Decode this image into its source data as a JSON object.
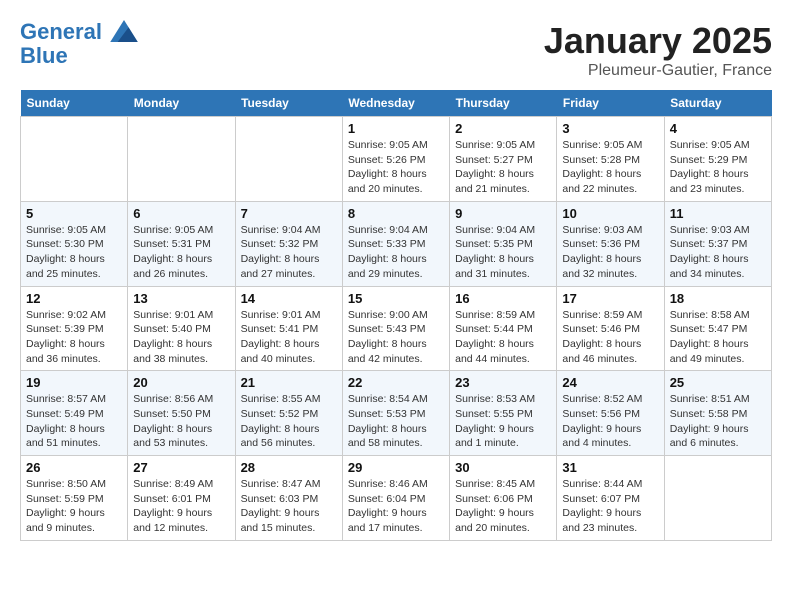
{
  "header": {
    "logo_line1": "General",
    "logo_line2": "Blue",
    "month": "January 2025",
    "location": "Pleumeur-Gautier, France"
  },
  "weekdays": [
    "Sunday",
    "Monday",
    "Tuesday",
    "Wednesday",
    "Thursday",
    "Friday",
    "Saturday"
  ],
  "weeks": [
    [
      {
        "day": "",
        "info": ""
      },
      {
        "day": "",
        "info": ""
      },
      {
        "day": "",
        "info": ""
      },
      {
        "day": "1",
        "info": "Sunrise: 9:05 AM\nSunset: 5:26 PM\nDaylight: 8 hours\nand 20 minutes."
      },
      {
        "day": "2",
        "info": "Sunrise: 9:05 AM\nSunset: 5:27 PM\nDaylight: 8 hours\nand 21 minutes."
      },
      {
        "day": "3",
        "info": "Sunrise: 9:05 AM\nSunset: 5:28 PM\nDaylight: 8 hours\nand 22 minutes."
      },
      {
        "day": "4",
        "info": "Sunrise: 9:05 AM\nSunset: 5:29 PM\nDaylight: 8 hours\nand 23 minutes."
      }
    ],
    [
      {
        "day": "5",
        "info": "Sunrise: 9:05 AM\nSunset: 5:30 PM\nDaylight: 8 hours\nand 25 minutes."
      },
      {
        "day": "6",
        "info": "Sunrise: 9:05 AM\nSunset: 5:31 PM\nDaylight: 8 hours\nand 26 minutes."
      },
      {
        "day": "7",
        "info": "Sunrise: 9:04 AM\nSunset: 5:32 PM\nDaylight: 8 hours\nand 27 minutes."
      },
      {
        "day": "8",
        "info": "Sunrise: 9:04 AM\nSunset: 5:33 PM\nDaylight: 8 hours\nand 29 minutes."
      },
      {
        "day": "9",
        "info": "Sunrise: 9:04 AM\nSunset: 5:35 PM\nDaylight: 8 hours\nand 31 minutes."
      },
      {
        "day": "10",
        "info": "Sunrise: 9:03 AM\nSunset: 5:36 PM\nDaylight: 8 hours\nand 32 minutes."
      },
      {
        "day": "11",
        "info": "Sunrise: 9:03 AM\nSunset: 5:37 PM\nDaylight: 8 hours\nand 34 minutes."
      }
    ],
    [
      {
        "day": "12",
        "info": "Sunrise: 9:02 AM\nSunset: 5:39 PM\nDaylight: 8 hours\nand 36 minutes."
      },
      {
        "day": "13",
        "info": "Sunrise: 9:01 AM\nSunset: 5:40 PM\nDaylight: 8 hours\nand 38 minutes."
      },
      {
        "day": "14",
        "info": "Sunrise: 9:01 AM\nSunset: 5:41 PM\nDaylight: 8 hours\nand 40 minutes."
      },
      {
        "day": "15",
        "info": "Sunrise: 9:00 AM\nSunset: 5:43 PM\nDaylight: 8 hours\nand 42 minutes."
      },
      {
        "day": "16",
        "info": "Sunrise: 8:59 AM\nSunset: 5:44 PM\nDaylight: 8 hours\nand 44 minutes."
      },
      {
        "day": "17",
        "info": "Sunrise: 8:59 AM\nSunset: 5:46 PM\nDaylight: 8 hours\nand 46 minutes."
      },
      {
        "day": "18",
        "info": "Sunrise: 8:58 AM\nSunset: 5:47 PM\nDaylight: 8 hours\nand 49 minutes."
      }
    ],
    [
      {
        "day": "19",
        "info": "Sunrise: 8:57 AM\nSunset: 5:49 PM\nDaylight: 8 hours\nand 51 minutes."
      },
      {
        "day": "20",
        "info": "Sunrise: 8:56 AM\nSunset: 5:50 PM\nDaylight: 8 hours\nand 53 minutes."
      },
      {
        "day": "21",
        "info": "Sunrise: 8:55 AM\nSunset: 5:52 PM\nDaylight: 8 hours\nand 56 minutes."
      },
      {
        "day": "22",
        "info": "Sunrise: 8:54 AM\nSunset: 5:53 PM\nDaylight: 8 hours\nand 58 minutes."
      },
      {
        "day": "23",
        "info": "Sunrise: 8:53 AM\nSunset: 5:55 PM\nDaylight: 9 hours\nand 1 minute."
      },
      {
        "day": "24",
        "info": "Sunrise: 8:52 AM\nSunset: 5:56 PM\nDaylight: 9 hours\nand 4 minutes."
      },
      {
        "day": "25",
        "info": "Sunrise: 8:51 AM\nSunset: 5:58 PM\nDaylight: 9 hours\nand 6 minutes."
      }
    ],
    [
      {
        "day": "26",
        "info": "Sunrise: 8:50 AM\nSunset: 5:59 PM\nDaylight: 9 hours\nand 9 minutes."
      },
      {
        "day": "27",
        "info": "Sunrise: 8:49 AM\nSunset: 6:01 PM\nDaylight: 9 hours\nand 12 minutes."
      },
      {
        "day": "28",
        "info": "Sunrise: 8:47 AM\nSunset: 6:03 PM\nDaylight: 9 hours\nand 15 minutes."
      },
      {
        "day": "29",
        "info": "Sunrise: 8:46 AM\nSunset: 6:04 PM\nDaylight: 9 hours\nand 17 minutes."
      },
      {
        "day": "30",
        "info": "Sunrise: 8:45 AM\nSunset: 6:06 PM\nDaylight: 9 hours\nand 20 minutes."
      },
      {
        "day": "31",
        "info": "Sunrise: 8:44 AM\nSunset: 6:07 PM\nDaylight: 9 hours\nand 23 minutes."
      },
      {
        "day": "",
        "info": ""
      }
    ]
  ]
}
